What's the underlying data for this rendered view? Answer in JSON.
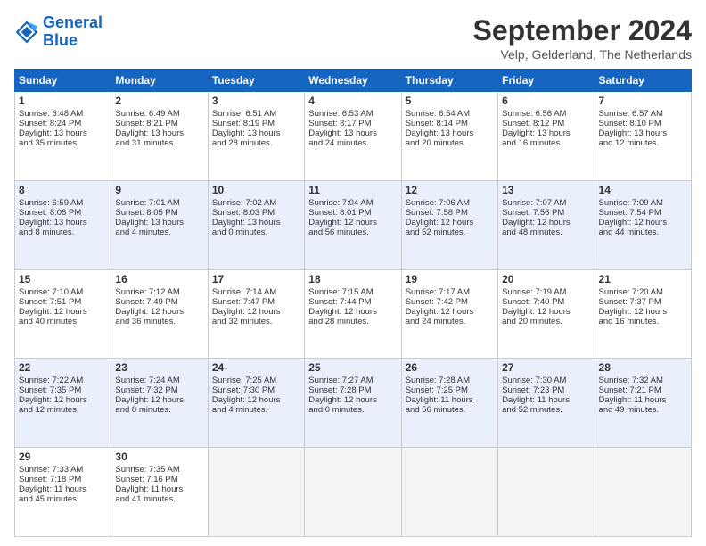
{
  "logo": {
    "line1": "General",
    "line2": "Blue"
  },
  "title": "September 2024",
  "location": "Velp, Gelderland, The Netherlands",
  "headers": [
    "Sunday",
    "Monday",
    "Tuesday",
    "Wednesday",
    "Thursday",
    "Friday",
    "Saturday"
  ],
  "weeks": [
    [
      {
        "day": "1",
        "lines": [
          "Sunrise: 6:48 AM",
          "Sunset: 8:24 PM",
          "Daylight: 13 hours",
          "and 35 minutes."
        ]
      },
      {
        "day": "2",
        "lines": [
          "Sunrise: 6:49 AM",
          "Sunset: 8:21 PM",
          "Daylight: 13 hours",
          "and 31 minutes."
        ]
      },
      {
        "day": "3",
        "lines": [
          "Sunrise: 6:51 AM",
          "Sunset: 8:19 PM",
          "Daylight: 13 hours",
          "and 28 minutes."
        ]
      },
      {
        "day": "4",
        "lines": [
          "Sunrise: 6:53 AM",
          "Sunset: 8:17 PM",
          "Daylight: 13 hours",
          "and 24 minutes."
        ]
      },
      {
        "day": "5",
        "lines": [
          "Sunrise: 6:54 AM",
          "Sunset: 8:14 PM",
          "Daylight: 13 hours",
          "and 20 minutes."
        ]
      },
      {
        "day": "6",
        "lines": [
          "Sunrise: 6:56 AM",
          "Sunset: 8:12 PM",
          "Daylight: 13 hours",
          "and 16 minutes."
        ]
      },
      {
        "day": "7",
        "lines": [
          "Sunrise: 6:57 AM",
          "Sunset: 8:10 PM",
          "Daylight: 13 hours",
          "and 12 minutes."
        ]
      }
    ],
    [
      {
        "day": "8",
        "lines": [
          "Sunrise: 6:59 AM",
          "Sunset: 8:08 PM",
          "Daylight: 13 hours",
          "and 8 minutes."
        ]
      },
      {
        "day": "9",
        "lines": [
          "Sunrise: 7:01 AM",
          "Sunset: 8:05 PM",
          "Daylight: 13 hours",
          "and 4 minutes."
        ]
      },
      {
        "day": "10",
        "lines": [
          "Sunrise: 7:02 AM",
          "Sunset: 8:03 PM",
          "Daylight: 13 hours",
          "and 0 minutes."
        ]
      },
      {
        "day": "11",
        "lines": [
          "Sunrise: 7:04 AM",
          "Sunset: 8:01 PM",
          "Daylight: 12 hours",
          "and 56 minutes."
        ]
      },
      {
        "day": "12",
        "lines": [
          "Sunrise: 7:06 AM",
          "Sunset: 7:58 PM",
          "Daylight: 12 hours",
          "and 52 minutes."
        ]
      },
      {
        "day": "13",
        "lines": [
          "Sunrise: 7:07 AM",
          "Sunset: 7:56 PM",
          "Daylight: 12 hours",
          "and 48 minutes."
        ]
      },
      {
        "day": "14",
        "lines": [
          "Sunrise: 7:09 AM",
          "Sunset: 7:54 PM",
          "Daylight: 12 hours",
          "and 44 minutes."
        ]
      }
    ],
    [
      {
        "day": "15",
        "lines": [
          "Sunrise: 7:10 AM",
          "Sunset: 7:51 PM",
          "Daylight: 12 hours",
          "and 40 minutes."
        ]
      },
      {
        "day": "16",
        "lines": [
          "Sunrise: 7:12 AM",
          "Sunset: 7:49 PM",
          "Daylight: 12 hours",
          "and 36 minutes."
        ]
      },
      {
        "day": "17",
        "lines": [
          "Sunrise: 7:14 AM",
          "Sunset: 7:47 PM",
          "Daylight: 12 hours",
          "and 32 minutes."
        ]
      },
      {
        "day": "18",
        "lines": [
          "Sunrise: 7:15 AM",
          "Sunset: 7:44 PM",
          "Daylight: 12 hours",
          "and 28 minutes."
        ]
      },
      {
        "day": "19",
        "lines": [
          "Sunrise: 7:17 AM",
          "Sunset: 7:42 PM",
          "Daylight: 12 hours",
          "and 24 minutes."
        ]
      },
      {
        "day": "20",
        "lines": [
          "Sunrise: 7:19 AM",
          "Sunset: 7:40 PM",
          "Daylight: 12 hours",
          "and 20 minutes."
        ]
      },
      {
        "day": "21",
        "lines": [
          "Sunrise: 7:20 AM",
          "Sunset: 7:37 PM",
          "Daylight: 12 hours",
          "and 16 minutes."
        ]
      }
    ],
    [
      {
        "day": "22",
        "lines": [
          "Sunrise: 7:22 AM",
          "Sunset: 7:35 PM",
          "Daylight: 12 hours",
          "and 12 minutes."
        ]
      },
      {
        "day": "23",
        "lines": [
          "Sunrise: 7:24 AM",
          "Sunset: 7:32 PM",
          "Daylight: 12 hours",
          "and 8 minutes."
        ]
      },
      {
        "day": "24",
        "lines": [
          "Sunrise: 7:25 AM",
          "Sunset: 7:30 PM",
          "Daylight: 12 hours",
          "and 4 minutes."
        ]
      },
      {
        "day": "25",
        "lines": [
          "Sunrise: 7:27 AM",
          "Sunset: 7:28 PM",
          "Daylight: 12 hours",
          "and 0 minutes."
        ]
      },
      {
        "day": "26",
        "lines": [
          "Sunrise: 7:28 AM",
          "Sunset: 7:25 PM",
          "Daylight: 11 hours",
          "and 56 minutes."
        ]
      },
      {
        "day": "27",
        "lines": [
          "Sunrise: 7:30 AM",
          "Sunset: 7:23 PM",
          "Daylight: 11 hours",
          "and 52 minutes."
        ]
      },
      {
        "day": "28",
        "lines": [
          "Sunrise: 7:32 AM",
          "Sunset: 7:21 PM",
          "Daylight: 11 hours",
          "and 49 minutes."
        ]
      }
    ],
    [
      {
        "day": "29",
        "lines": [
          "Sunrise: 7:33 AM",
          "Sunset: 7:18 PM",
          "Daylight: 11 hours",
          "and 45 minutes."
        ]
      },
      {
        "day": "30",
        "lines": [
          "Sunrise: 7:35 AM",
          "Sunset: 7:16 PM",
          "Daylight: 11 hours",
          "and 41 minutes."
        ]
      },
      null,
      null,
      null,
      null,
      null
    ]
  ]
}
